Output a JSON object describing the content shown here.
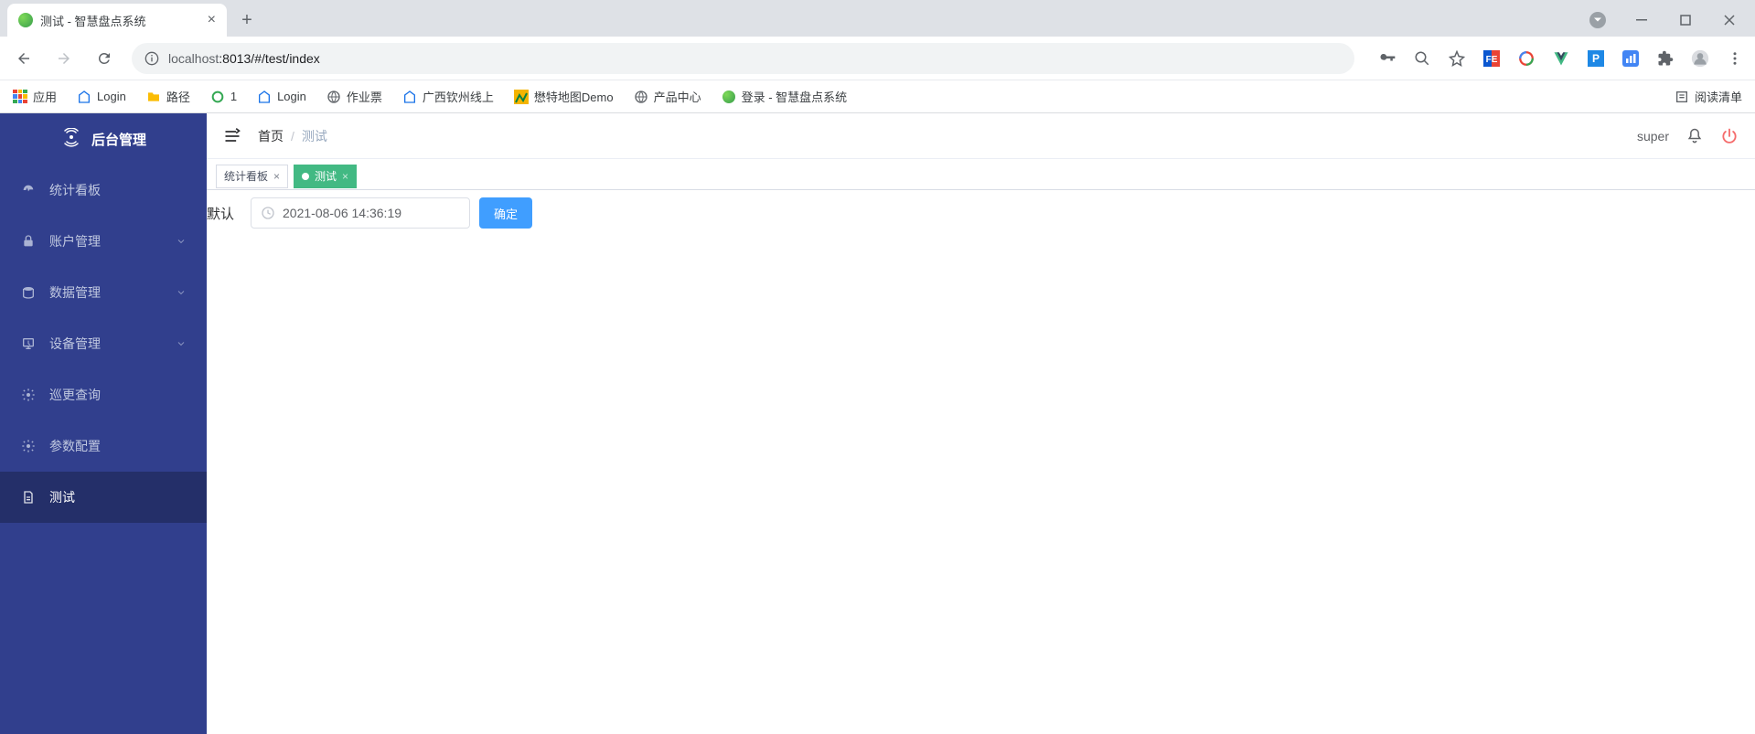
{
  "browser": {
    "tab_title": "测试 - 智慧盘点系统",
    "url_display": "localhost:8013/#/test/index",
    "url_host_prefix": "localhost",
    "url_path": ":8013/#/test/index",
    "bookmarks": {
      "apps": "应用",
      "items": [
        {
          "label": "Login"
        },
        {
          "label": "路径"
        },
        {
          "label": "1"
        },
        {
          "label": "Login"
        },
        {
          "label": "作业票"
        },
        {
          "label": "广西钦州线上"
        },
        {
          "label": "懋特地图Demo"
        },
        {
          "label": "产品中心"
        },
        {
          "label": "登录 - 智慧盘点系统"
        }
      ],
      "reading_list": "阅读清单"
    }
  },
  "sidebar": {
    "logo_title": "后台管理",
    "items": [
      {
        "icon": "dashboard",
        "label": "统计看板",
        "expandable": false,
        "active": false
      },
      {
        "icon": "lock",
        "label": "账户管理",
        "expandable": true,
        "active": false
      },
      {
        "icon": "database",
        "label": "数据管理",
        "expandable": true,
        "active": false
      },
      {
        "icon": "device",
        "label": "设备管理",
        "expandable": true,
        "active": false
      },
      {
        "icon": "gear",
        "label": "巡更查询",
        "expandable": false,
        "active": false
      },
      {
        "icon": "gear",
        "label": "参数配置",
        "expandable": false,
        "active": false
      },
      {
        "icon": "doc",
        "label": "测试",
        "expandable": false,
        "active": true
      }
    ]
  },
  "header": {
    "breadcrumb": {
      "home": "首页",
      "current": "测试"
    },
    "username": "super"
  },
  "tabs": [
    {
      "label": "统计看板",
      "active": false,
      "closable": true
    },
    {
      "label": "测试",
      "active": true,
      "closable": true
    }
  ],
  "content": {
    "label": "默认",
    "date_value": "2021-08-06 14:36:19",
    "confirm_label": "确定"
  }
}
